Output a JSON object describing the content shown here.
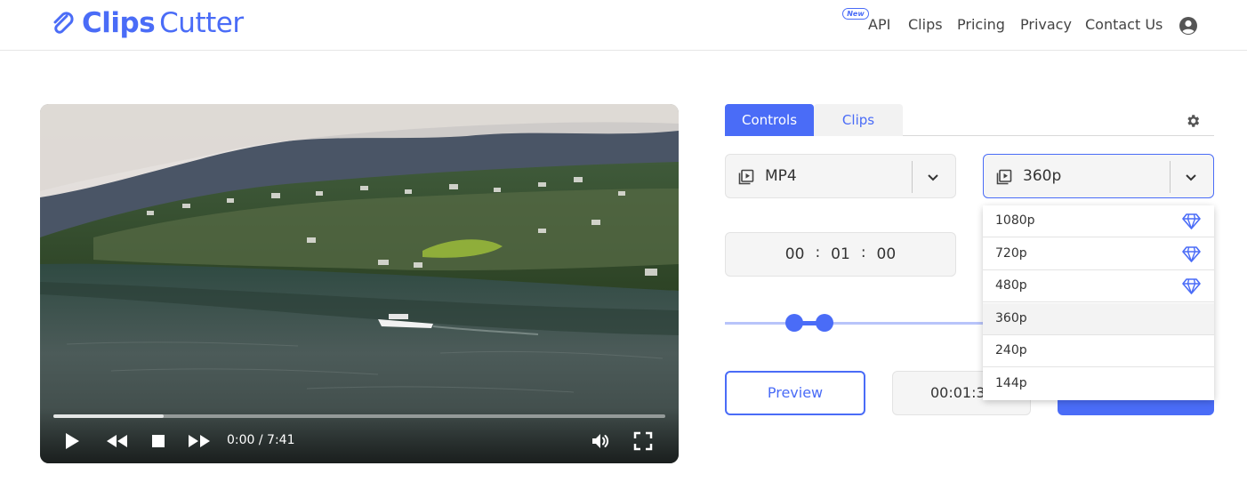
{
  "brand": {
    "part1": "Clips",
    "part2": "Cutter",
    "accent_color": "#4a6cf7"
  },
  "nav": {
    "new_badge": "New",
    "items": [
      "API",
      "Clips",
      "Pricing",
      "Privacy",
      "Contact Us"
    ],
    "user_icon": "user-circle-icon"
  },
  "player": {
    "time": "0:00 / 7:41",
    "progress_fraction": 0.18,
    "icons": [
      "play-icon",
      "rewind-icon",
      "stop-icon",
      "fast-forward-icon",
      "volume-icon",
      "fullscreen-icon"
    ]
  },
  "panel": {
    "tabs": [
      "Controls",
      "Clips"
    ],
    "active_tab": "Controls",
    "settings_icon": "gear-icon",
    "format": {
      "value": "MP4",
      "icon": "video-file-icon"
    },
    "resolution": {
      "value": "360p",
      "icon": "video-file-icon",
      "options": [
        {
          "label": "1080p",
          "premium": true
        },
        {
          "label": "720p",
          "premium": true
        },
        {
          "label": "480p",
          "premium": true
        },
        {
          "label": "360p",
          "premium": false,
          "selected": true
        },
        {
          "label": "240p",
          "premium": false
        },
        {
          "label": "144p",
          "premium": false
        }
      ]
    },
    "start_time": {
      "hh": "00",
      "mm": "01",
      "ss": "00",
      "sep": ":"
    },
    "preview_label": "Preview",
    "duration_text": "00:01:3"
  }
}
